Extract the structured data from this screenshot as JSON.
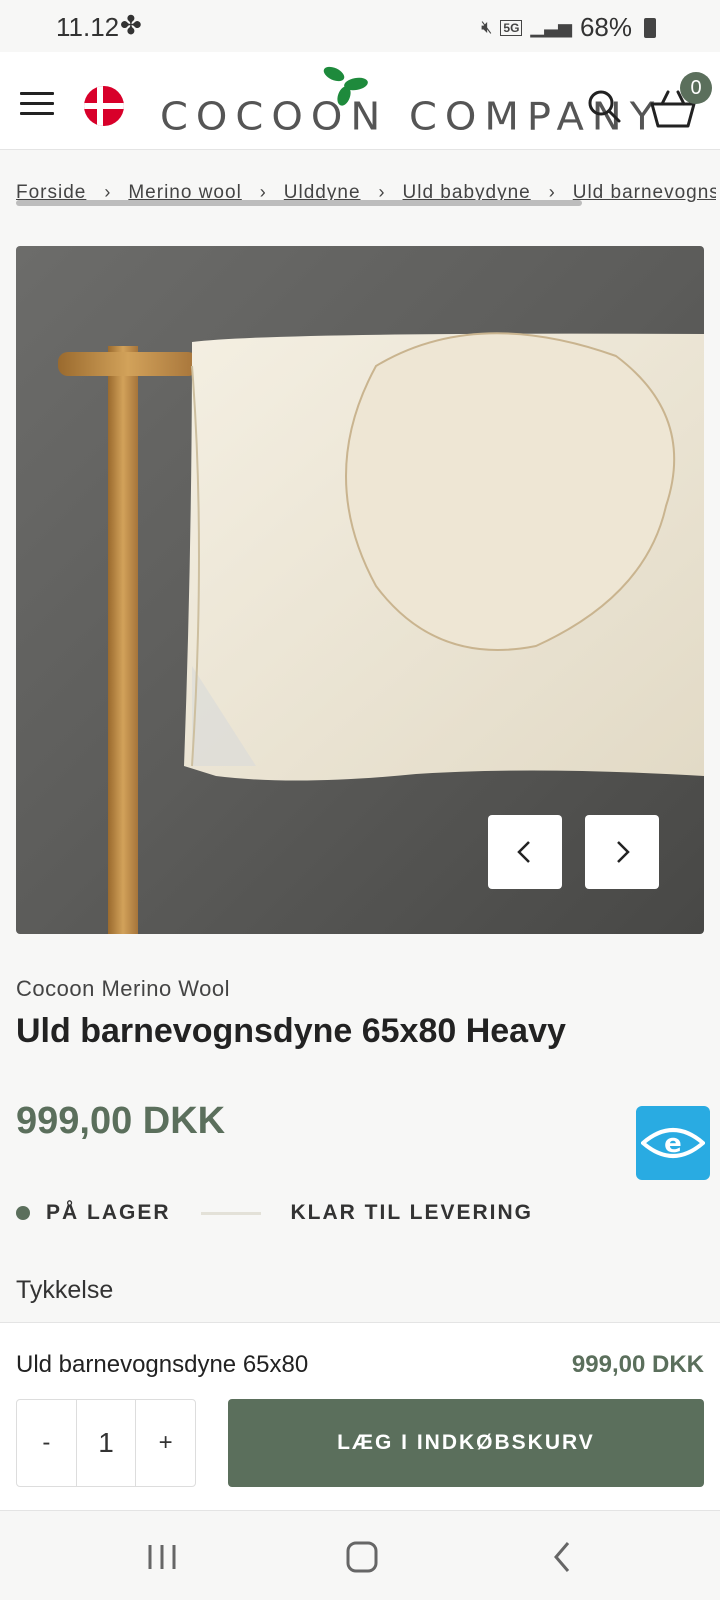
{
  "status_bar": {
    "time": "11.12",
    "battery": "68%",
    "network": "5G"
  },
  "header": {
    "logo_text": "COCOON COMPANY",
    "cart_count": "0",
    "brand_color": "#5b6f5c"
  },
  "breadcrumb": {
    "items": [
      "Forside",
      "Merino wool",
      "Ulddyne",
      "Uld babydyne",
      "Uld barnevognsdyne"
    ]
  },
  "product": {
    "brand": "Cocoon Merino Wool",
    "title": "Uld barnevognsdyne 65x80 Heavy",
    "price": "999,00 DKK",
    "stock_status": "PÅ LAGER",
    "delivery_status": "KLAR TIL LEVERING",
    "variant_label": "Tykkelse"
  },
  "sticky_bar": {
    "name": "Uld barnevognsdyne 65x80",
    "price": "999,00 DKK",
    "qty_minus": "-",
    "qty_value": "1",
    "qty_plus": "+",
    "add_to_cart": "LÆG I INDKØBSKURV"
  }
}
